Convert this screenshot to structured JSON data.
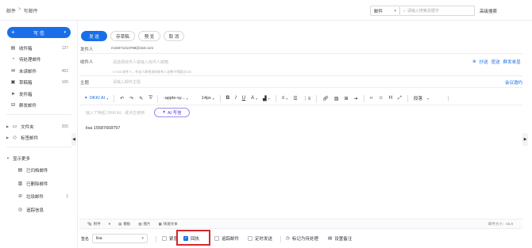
{
  "breadcrumb": {
    "root": "邮件",
    "separator": ">",
    "current": "写邮件"
  },
  "search": {
    "scope": "邮件",
    "placeholder": "请输入搜索关键字",
    "advanced": "高级搜索"
  },
  "sidebar": {
    "compose": "写 信",
    "items": [
      {
        "label": "收件箱",
        "count": "127",
        "icon": "inbox-icon"
      },
      {
        "label": "待处理邮件",
        "count": "",
        "icon": "pending-icon"
      },
      {
        "label": "未读邮件",
        "count": "462",
        "icon": "unread-icon"
      },
      {
        "label": "草稿箱",
        "count": "165",
        "icon": "draft-icon"
      },
      {
        "label": "发件箱",
        "count": "",
        "icon": "outbox-icon"
      },
      {
        "label": "群发邮件",
        "count": "",
        "icon": "mass-mail-icon"
      }
    ],
    "groups": [
      {
        "label": "文件夹",
        "count": "355"
      },
      {
        "label": "标签邮件",
        "count": ""
      }
    ],
    "more": {
      "label": "显示更多",
      "items": [
        {
          "label": "已归档邮件",
          "count": "",
          "icon": "archive-icon"
        },
        {
          "label": "已删除邮件",
          "count": "",
          "icon": "trash-icon"
        },
        {
          "label": "垃圾邮件",
          "count": "1",
          "icon": "spam-icon"
        },
        {
          "label": "追踪信息",
          "count": "",
          "icon": "track-icon"
        }
      ]
    }
  },
  "actions": {
    "send": "发 送",
    "save_draft": "存草稿",
    "preview": "预 览",
    "cancel": "取 消"
  },
  "form": {
    "from_label": "发件人",
    "from_value": "m15071213798@163.com",
    "to_label": "收件人",
    "to_placeholder": "请选择收件人或输入收件人邮箱",
    "to_tip": "0 /100 收件人，抄送人和密送的联系人总数不得超过100",
    "cc": "抄送",
    "bcc": "密送",
    "mass": "群发单显",
    "subject_label": "主题",
    "subject_placeholder": "请输入邮件主题",
    "meeting": "会议邀约"
  },
  "toolbar": {
    "ai": "OKKI AI",
    "font": "-apple-sy...",
    "size": "14px",
    "paragraph": "段落"
  },
  "editor": {
    "ai_prompt": "输入\"/\"唤起 OKKI AI，或点击使用",
    "ai_button": "AI 写信",
    "content": "lisa  15587668797"
  },
  "attachments": {
    "attach": "附件",
    "template": "模板",
    "image": "图片",
    "quick_text": "快速文本",
    "size": "邮件大小：55.8"
  },
  "footer": {
    "signature_label": "签名",
    "signature_value": "lisa",
    "urgent": "紧急",
    "receipt": "回执",
    "receipt_checked": true,
    "track": "追踪邮件",
    "scheduled": "定时发送",
    "mark_todo": "标记为待处理",
    "note": "设置备注"
  },
  "colors": {
    "accent": "#1a6fe8",
    "highlight": "#d9262c"
  }
}
